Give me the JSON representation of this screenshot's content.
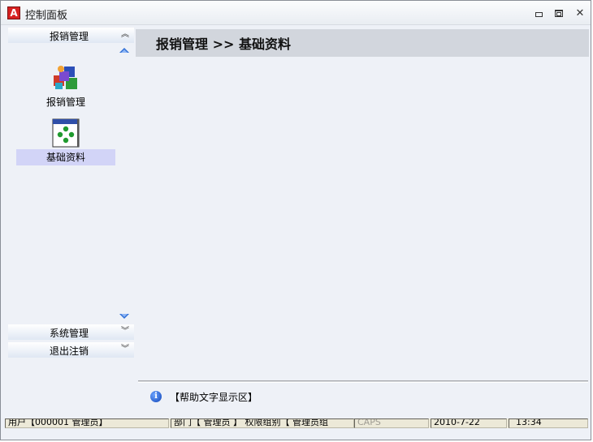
{
  "window": {
    "icon_letter": "A",
    "title": "控制面板"
  },
  "sidebar": {
    "groups": [
      {
        "label": "报销管理",
        "expanded": true
      },
      {
        "label": "系统管理",
        "expanded": false
      },
      {
        "label": "退出注销",
        "expanded": false
      }
    ],
    "items": [
      {
        "label": "报销管理",
        "icon": "reimbursement-cubes-icon",
        "selected": false
      },
      {
        "label": "基础资料",
        "icon": "basic-data-window-icon",
        "selected": true
      }
    ]
  },
  "main": {
    "breadcrumb": "报销管理 >> 基础资料"
  },
  "help": {
    "text": "【帮助文字显示区】"
  },
  "statusbar": {
    "user": "用户【000001 管理员】",
    "dept": "部门【 管理员 】 权限组别【 管理员组",
    "caps": "CAPS",
    "date": "2010-7-22",
    "time": "13:34"
  },
  "colors": {
    "window_bg": "#eef1f7",
    "header_bg": "#d2d6dd",
    "selected_item": "#d2d4f7",
    "accent_blue": "#2f6fd6"
  }
}
